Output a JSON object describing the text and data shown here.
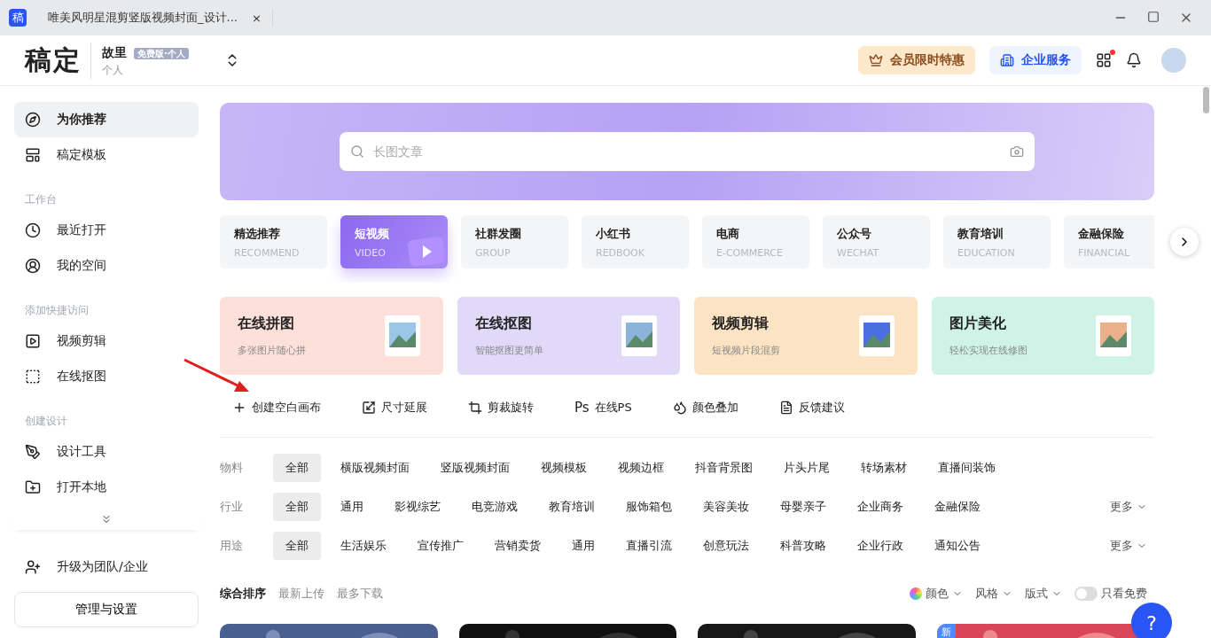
{
  "window": {
    "app_icon": "稿",
    "tab_title": "唯美风明星混剪竖版视频封面_设计...",
    "tab_close": "×"
  },
  "header": {
    "logo": "稿定",
    "account": "故里",
    "plan_badge": "免费版·个人",
    "account_type": "个人",
    "vip_button": "会员限时特惠",
    "enterprise_button": "企业服务",
    "apps_unread": true
  },
  "sidebar": {
    "top_items": [
      {
        "label": "为你推荐",
        "selected": true
      },
      {
        "label": "稿定模板",
        "selected": false
      }
    ],
    "sections": [
      {
        "title": "工作台",
        "items": [
          {
            "label": "最近打开",
            "selected": false
          },
          {
            "label": "我的空间",
            "selected": false
          }
        ]
      },
      {
        "title": "添加快捷访问",
        "items": [
          {
            "label": "视频剪辑",
            "selected": false
          },
          {
            "label": "在线抠图",
            "selected": false
          }
        ]
      },
      {
        "title": "创建设计",
        "items": [
          {
            "label": "设计工具",
            "selected": false
          },
          {
            "label": "打开本地",
            "selected": false
          }
        ]
      }
    ],
    "upgrade": "升级为团队/企业",
    "settings_button": "管理与设置"
  },
  "search": {
    "placeholder": "长图文章"
  },
  "categories": [
    {
      "label": "精选推荐",
      "sub": "RECOMMEND",
      "selected": false
    },
    {
      "label": "短视频",
      "sub": "VIDEO",
      "selected": true
    },
    {
      "label": "社群发圈",
      "sub": "GROUP",
      "selected": false
    },
    {
      "label": "小红书",
      "sub": "REDBOOK",
      "selected": false
    },
    {
      "label": "电商",
      "sub": "E-COMMERCE",
      "selected": false
    },
    {
      "label": "公众号",
      "sub": "WECHAT",
      "selected": false
    },
    {
      "label": "教育培训",
      "sub": "EDUCATION",
      "selected": false
    },
    {
      "label": "金融保险",
      "sub": "FINANCIAL",
      "selected": false
    }
  ],
  "tools": [
    {
      "title": "在线拼图",
      "desc": "多张图片随心拼",
      "color": "#fde0da"
    },
    {
      "title": "在线抠图",
      "desc": "智能抠图更简单",
      "color": "#e0d9f7"
    },
    {
      "title": "视频剪辑",
      "desc": "短视频片段混剪",
      "color": "#fbe3c4"
    },
    {
      "title": "图片美化",
      "desc": "轻松实现在线修图",
      "color": "#cff3e6"
    }
  ],
  "quick_actions": [
    {
      "label": "创建空白画布"
    },
    {
      "label": "尺寸延展"
    },
    {
      "label": "剪裁旋转"
    },
    {
      "label": "在线PS",
      "icon_text": "Ps"
    },
    {
      "label": "颜色叠加"
    },
    {
      "label": "反馈建议"
    }
  ],
  "filters": [
    {
      "label": "物料",
      "options": [
        {
          "label": "全部",
          "selected": true
        },
        {
          "label": "横版视频封面",
          "selected": false
        },
        {
          "label": "竖版视频封面",
          "selected": false
        },
        {
          "label": "视频模板",
          "selected": false
        },
        {
          "label": "视频边框",
          "selected": false
        },
        {
          "label": "抖音背景图",
          "selected": false
        },
        {
          "label": "片头片尾",
          "selected": false
        },
        {
          "label": "转场素材",
          "selected": false
        },
        {
          "label": "直播间装饰",
          "selected": false
        }
      ]
    },
    {
      "label": "行业",
      "more": "更多",
      "options": [
        {
          "label": "全部",
          "selected": true
        },
        {
          "label": "通用",
          "selected": false
        },
        {
          "label": "影视综艺",
          "selected": false
        },
        {
          "label": "电竞游戏",
          "selected": false
        },
        {
          "label": "教育培训",
          "selected": false
        },
        {
          "label": "服饰箱包",
          "selected": false
        },
        {
          "label": "美容美妆",
          "selected": false
        },
        {
          "label": "母婴亲子",
          "selected": false
        },
        {
          "label": "企业商务",
          "selected": false
        },
        {
          "label": "金融保险",
          "selected": false
        }
      ]
    },
    {
      "label": "用途",
      "more": "更多",
      "options": [
        {
          "label": "全部",
          "selected": true
        },
        {
          "label": "生活娱乐",
          "selected": false
        },
        {
          "label": "宣传推广",
          "selected": false
        },
        {
          "label": "营销卖货",
          "selected": false
        },
        {
          "label": "通用",
          "selected": false
        },
        {
          "label": "直播引流",
          "selected": false
        },
        {
          "label": "创意玩法",
          "selected": false
        },
        {
          "label": "科普攻略",
          "selected": false
        },
        {
          "label": "企业行政",
          "selected": false
        },
        {
          "label": "通知公告",
          "selected": false
        }
      ]
    }
  ],
  "sort": {
    "options": [
      {
        "label": "综合排序",
        "selected": true
      },
      {
        "label": "最新上传",
        "selected": false
      },
      {
        "label": "最多下载",
        "selected": false
      }
    ],
    "color_filter": "颜色",
    "style_filter": "风格",
    "layout_filter": "版式",
    "free_only": {
      "label": "只看免费",
      "on": false
    }
  },
  "results": [
    {
      "kind": "picture"
    },
    {
      "kind": "picture"
    },
    {
      "kind": "picture"
    },
    {
      "kind": "picture",
      "badge": "新"
    }
  ],
  "help_button": "?"
}
